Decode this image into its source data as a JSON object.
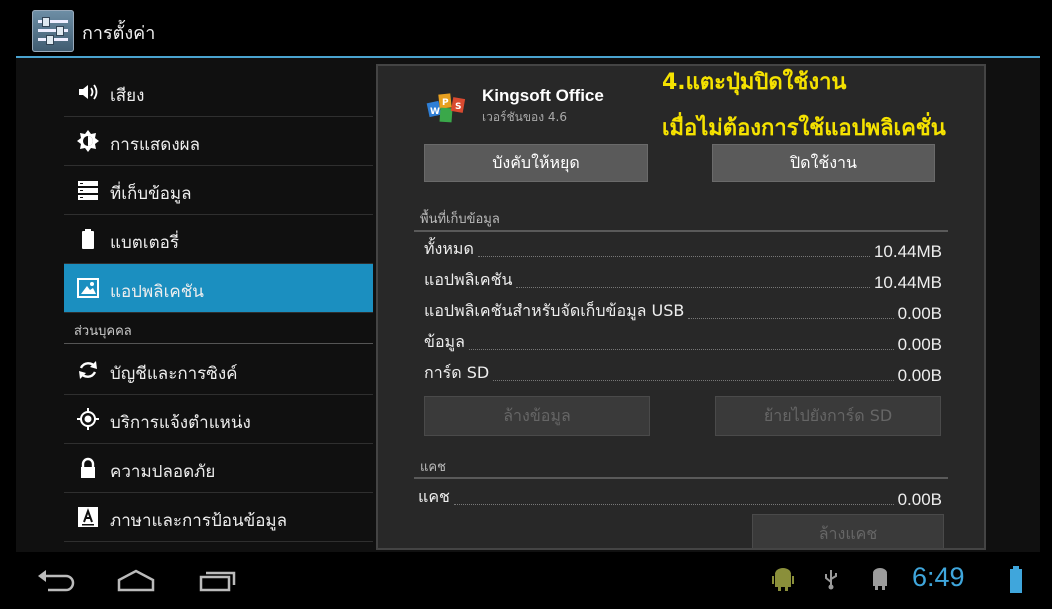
{
  "header": {
    "title": "การตั้งค่า"
  },
  "sidebar": {
    "items": [
      {
        "label": "เสียง",
        "icon": "volume-icon"
      },
      {
        "label": "การแสดงผล",
        "icon": "brightness-icon"
      },
      {
        "label": "ที่เก็บข้อมูล",
        "icon": "storage-icon"
      },
      {
        "label": "แบตเตอรี่",
        "icon": "battery-icon"
      },
      {
        "label": "แอปพลิเคชัน",
        "icon": "apps-icon",
        "selected": true
      }
    ],
    "section_personal": "ส่วนบุคคล",
    "personal_items": [
      {
        "label": "บัญชีและการซิงค์",
        "icon": "sync-icon"
      },
      {
        "label": "บริการแจ้งตำแหน่ง",
        "icon": "location-icon"
      },
      {
        "label": "ความปลอดภัย",
        "icon": "lock-icon"
      },
      {
        "label": "ภาษาและการป้อนข้อมูล",
        "icon": "language-icon"
      }
    ]
  },
  "app": {
    "name": "Kingsoft Office",
    "version": "เวอร์ชันของ 4.6",
    "force_stop_label": "บังคับให้หยุด",
    "disable_label": "ปิดใช้งาน",
    "storage": {
      "header": "พื้นที่เก็บข้อมูล",
      "rows": [
        {
          "label": "ทั้งหมด",
          "value": "10.44MB"
        },
        {
          "label": "แอปพลิเคชัน",
          "value": "10.44MB"
        },
        {
          "label": "แอปพลิเคชันสำหรับจัดเก็บข้อมูล USB",
          "value": "0.00B"
        },
        {
          "label": "ข้อมูล",
          "value": "0.00B"
        },
        {
          "label": "การ์ด SD",
          "value": "0.00B"
        }
      ],
      "clear_data_label": "ล้างข้อมูล",
      "move_sd_label": "ย้ายไปยังการ์ด SD"
    },
    "cache": {
      "header": "แคช",
      "row": {
        "label": "แคช",
        "value": "0.00B"
      },
      "clear_cache_label": "ล้างแคช"
    }
  },
  "annotation": {
    "line1": "4.แตะปุ่มปิดใช้งาน",
    "line2": "เมื่อไม่ต้องการใช้แอปพลิเคชั่น",
    "color": "#f5e200"
  },
  "statusbar": {
    "time": "6:49"
  },
  "colors": {
    "accent": "#1b8fc0",
    "clock": "#3fa6dc"
  }
}
